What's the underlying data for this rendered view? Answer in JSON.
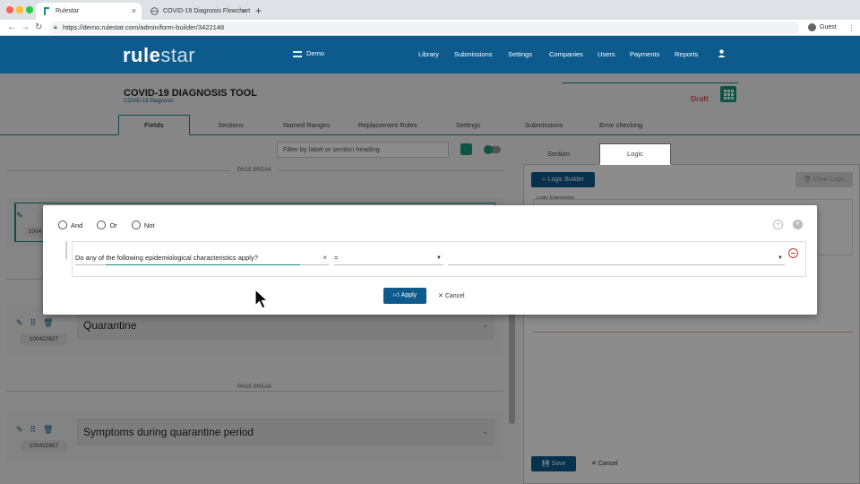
{
  "browser": {
    "tabs": [
      {
        "title": "Rulestar",
        "active": true
      },
      {
        "title": "COVID-19 Diagnosis Flowchart",
        "active": false
      }
    ],
    "url": "https://demo.rulestar.com/admin/form-builder/3422148",
    "profile": "Guest"
  },
  "header": {
    "logo_main": "rule",
    "logo_rest": "star",
    "workspace": "Demo",
    "nav": [
      "Library",
      "Submissions",
      "Settings",
      "Companies",
      "Users",
      "Payments",
      "Reports"
    ]
  },
  "form": {
    "title": "COVID-19 DIAGNOSIS TOOL",
    "subtitle": "COVID-19 Diagnosis",
    "status": "Draft",
    "tabs": [
      "Fields",
      "Sections",
      "Named Ranges",
      "Replacement Rules",
      "Settings",
      "Submissions",
      "Error checking"
    ],
    "filter_placeholder": "Filter by label or section heading",
    "page_break_label": "PAGE BREAK",
    "fields": [
      {
        "id": "100422827",
        "label": "Quarantine"
      },
      {
        "id": "100422867",
        "label": "Symptoms during quarantine period"
      }
    ],
    "selected_id_partial": "1004"
  },
  "right_panel": {
    "tabs": [
      "Section",
      "Logic"
    ],
    "logic_builder_label": "Logic Builder",
    "clear_logic_label": "Clear Logic",
    "logic_expression_label": "Logic Expression",
    "save_label": "Save",
    "cancel_label": "Cancel"
  },
  "modal": {
    "operators": [
      "And",
      "Or",
      "Not"
    ],
    "condition_field": "Do any of the following epidemiological characteristics apply?",
    "condition_operator": "=",
    "condition_value": "",
    "apply_label": "Apply",
    "cancel_label": "Cancel"
  },
  "colors": {
    "brand": "#0d5a8c",
    "accent": "#1a9a7e",
    "draft": "#d9534f"
  }
}
